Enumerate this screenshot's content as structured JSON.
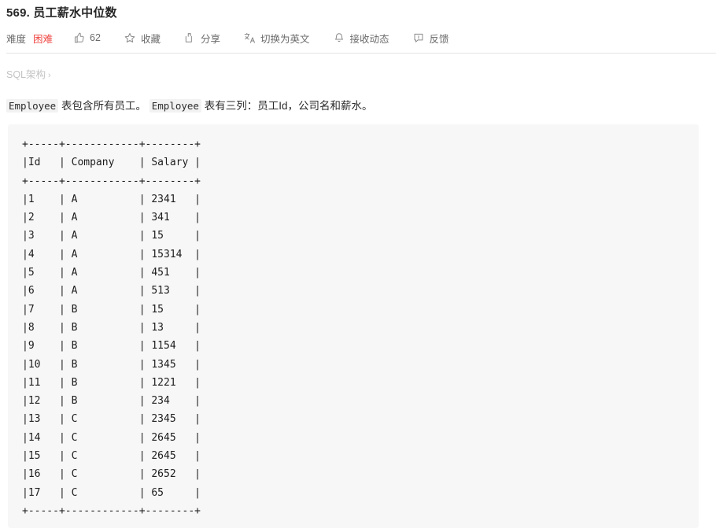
{
  "header": {
    "title": "569. 员工薪水中位数",
    "toolbar": {
      "difficulty_label": "难度",
      "difficulty_value": "困难",
      "like_count": "62",
      "favorite_label": "收藏",
      "share_label": "分享",
      "translate_label": "切换为英文",
      "subscribe_label": "接收动态",
      "feedback_label": "反馈"
    },
    "colors": {
      "difficulty_hard": "#ef4743",
      "icon_gray": "#8a8a8a",
      "text_gray": "#6b6b6b",
      "code_bg": "#f7f7f7",
      "chip_bg": "#f2f2f2"
    }
  },
  "breadcrumb": {
    "label": "SQL架构",
    "chevron": "›"
  },
  "description": {
    "chip1": "Employee",
    "text1": "表包含所有员工。",
    "chip2": "Employee",
    "text2": "表有三列：员工Id，公司名和薪水。"
  },
  "table": {
    "columns": [
      "Id",
      "Company",
      "Salary"
    ],
    "rows": [
      {
        "id": "1",
        "company": "A",
        "salary": "2341"
      },
      {
        "id": "2",
        "company": "A",
        "salary": "341"
      },
      {
        "id": "3",
        "company": "A",
        "salary": "15"
      },
      {
        "id": "4",
        "company": "A",
        "salary": "15314"
      },
      {
        "id": "5",
        "company": "A",
        "salary": "451"
      },
      {
        "id": "6",
        "company": "A",
        "salary": "513"
      },
      {
        "id": "7",
        "company": "B",
        "salary": "15"
      },
      {
        "id": "8",
        "company": "B",
        "salary": "13"
      },
      {
        "id": "9",
        "company": "B",
        "salary": "1154"
      },
      {
        "id": "10",
        "company": "B",
        "salary": "1345"
      },
      {
        "id": "11",
        "company": "B",
        "salary": "1221"
      },
      {
        "id": "12",
        "company": "B",
        "salary": "234"
      },
      {
        "id": "13",
        "company": "C",
        "salary": "2345"
      },
      {
        "id": "14",
        "company": "C",
        "salary": "2645"
      },
      {
        "id": "15",
        "company": "C",
        "salary": "2645"
      },
      {
        "id": "16",
        "company": "C",
        "salary": "2652"
      },
      {
        "id": "17",
        "company": "C",
        "salary": "65"
      }
    ],
    "ascii": "+-----+------------+--------+\n|Id   | Company    | Salary |\n+-----+------------+--------+\n|1    | A          | 2341   |\n|2    | A          | 341    |\n|3    | A          | 15     |\n|4    | A          | 15314  |\n|5    | A          | 451    |\n|6    | A          | 513    |\n|7    | B          | 15     |\n|8    | B          | 13     |\n|9    | B          | 1154   |\n|10   | B          | 1345   |\n|11   | B          | 1221   |\n|12   | B          | 234    |\n|13   | C          | 2345   |\n|14   | C          | 2645   |\n|15   | C          | 2645   |\n|16   | C          | 2652   |\n|17   | C          | 65     |\n+-----+------------+--------+"
  }
}
